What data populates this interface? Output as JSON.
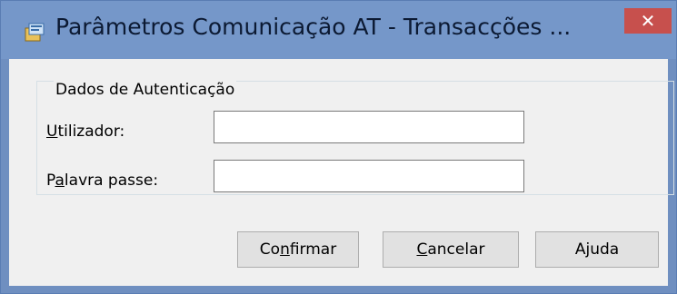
{
  "window": {
    "title": "Parâmetros Comunicação AT - Transacções ...",
    "close_label": "✕"
  },
  "auth_group": {
    "legend": "Dados de Autenticação",
    "user_label_mnemonic": "U",
    "user_label_rest": "tilizador:",
    "user_value": "",
    "password_label_pre": "P",
    "password_label_mnemonic": "a",
    "password_label_rest": "lavra passe:",
    "password_value": ""
  },
  "buttons": {
    "confirm_pre": "Co",
    "confirm_mnemonic": "n",
    "confirm_rest": "firmar",
    "cancel_mnemonic": "C",
    "cancel_rest": "ancelar",
    "help_pre": "A",
    "help_mnemonic": "j",
    "help_rest": "uda"
  },
  "colors": {
    "titlebar": "#7597c9",
    "close_button": "#c7504d",
    "dialog_background": "#f0f0f0"
  }
}
